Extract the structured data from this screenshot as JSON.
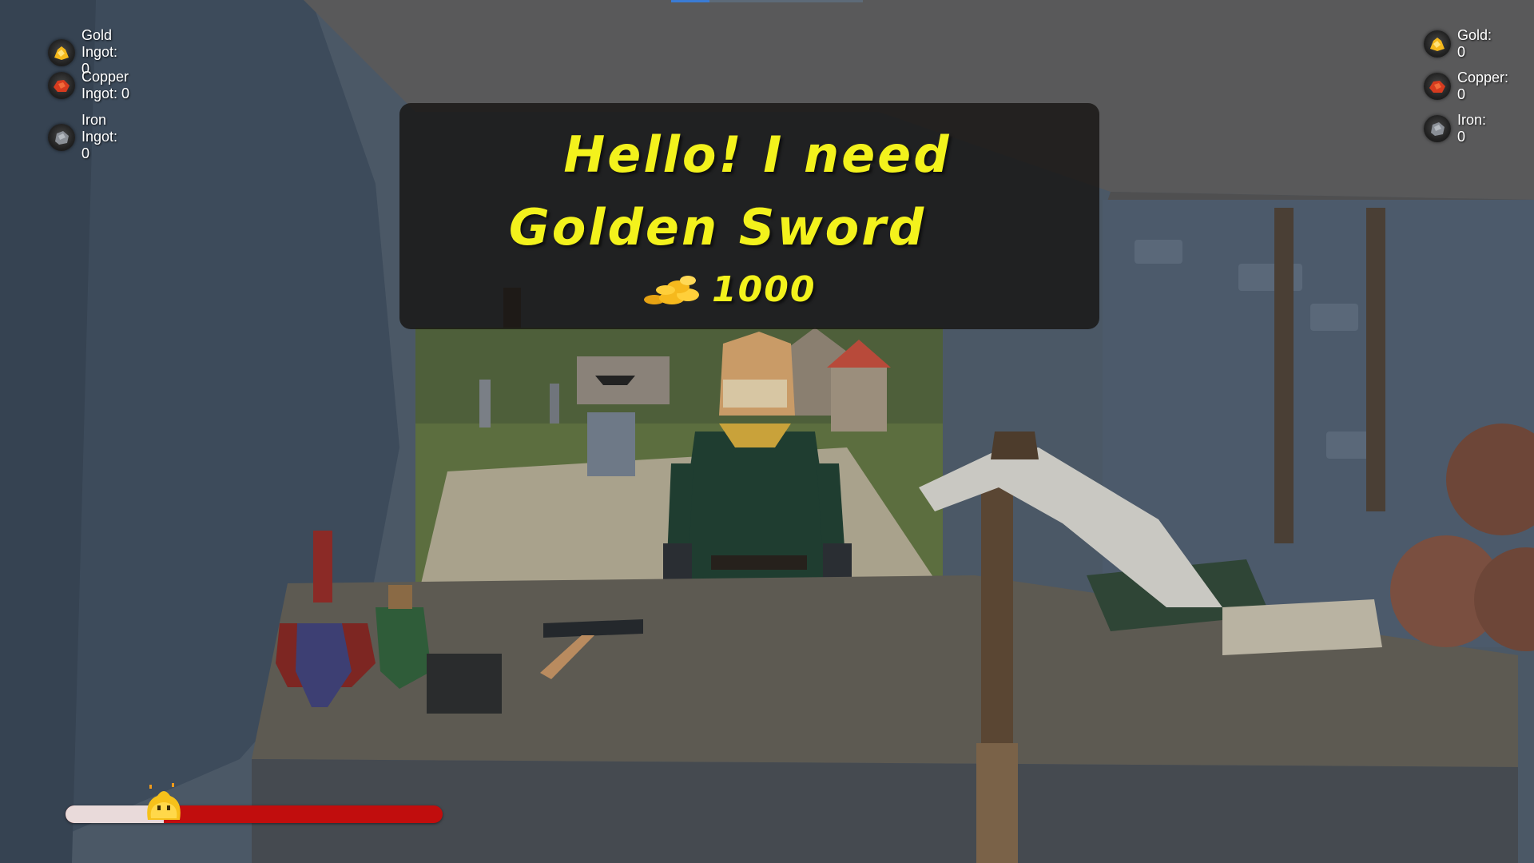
{
  "hud": {
    "left": [
      {
        "label": "Gold Ingot: 0",
        "icon": "gold-nugget-icon",
        "color": "#f4b81c"
      },
      {
        "label": "Copper Ingot: 0",
        "icon": "copper-ore-icon",
        "color": "#d63b1f"
      },
      {
        "label": "Iron Ingot: 0",
        "icon": "iron-ore-icon",
        "color": "#8a8f96"
      }
    ],
    "right": [
      {
        "label": "Gold: 0",
        "icon": "gold-nugget-icon",
        "color": "#f4b81c"
      },
      {
        "label": "Copper: 0",
        "icon": "copper-ore-icon",
        "color": "#d63b1f"
      },
      {
        "label": "Iron: 0",
        "icon": "iron-ore-icon",
        "color": "#8a8f96"
      }
    ]
  },
  "dialog": {
    "line1": "Hello! I need",
    "line2": "Golden  Sword",
    "reward_amount": "1000",
    "reward_icon": "gold-coins-icon",
    "text_color": "#f3f21c"
  },
  "progress": {
    "fraction": 0.26,
    "fill_color": "#e9dada",
    "track_color": "#c10d0d",
    "marker_icon": "yellow-blob-icon"
  }
}
